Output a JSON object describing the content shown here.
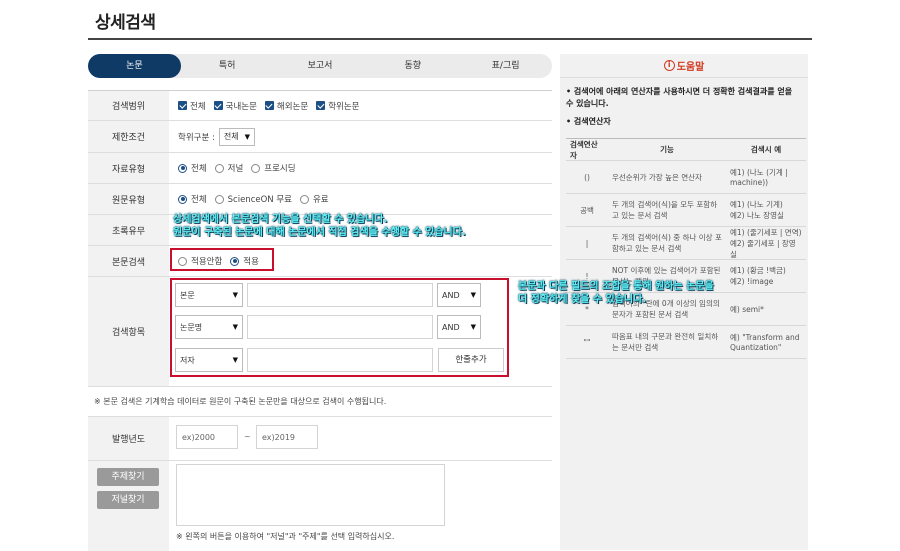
{
  "page": {
    "title": "상세검색"
  },
  "tabs": [
    "논문",
    "특허",
    "보고서",
    "동향",
    "표/그림"
  ],
  "form": {
    "range": {
      "label": "검색범위",
      "options": [
        "전체",
        "국내논문",
        "해외논문",
        "학위논문"
      ]
    },
    "limit": {
      "label": "제한조건",
      "sub_label": "학위구분 :",
      "selected": "전체"
    },
    "material": {
      "label": "자료유형",
      "options": [
        "전체",
        "저널",
        "프로시딩"
      ]
    },
    "original": {
      "label": "원문유형",
      "options": [
        "전체",
        "ScienceON 무료",
        "유료"
      ]
    },
    "abstract": {
      "label": "초록유무"
    },
    "fulltext": {
      "label": "본문검색",
      "options": [
        "적용안함",
        "적용"
      ]
    },
    "search_items": {
      "label": "검색항목",
      "rows": [
        {
          "field": "본문",
          "op": "AND"
        },
        {
          "field": "논문명",
          "op": "AND"
        },
        {
          "field": "저자",
          "add": "한줄추가"
        }
      ]
    },
    "note": "※ 본문 검색은 기계학습 데이터로 원문이 구축된 논문만을 대상으로 검색이 수행됩니다.",
    "year": {
      "label": "발행년도",
      "from_placeholder": "ex)2000",
      "sep": "~",
      "to_placeholder": "ex)2019"
    },
    "subject_btn": "주제찾기",
    "journal_btn": "저널찾기",
    "bottom_note": "※ 왼쪽의 버튼을 이용하여 \"저널\"과 \"주제\"를 선택 입력하십시오."
  },
  "callouts": {
    "one_line1": "상세검색에서 본문검색 기능을 선택할 수 있습니다.",
    "one_line2": "원문이 구축된 논문에 대해 논문에서 직접 검색을 수행할 수 있습니다.",
    "two_line1": "본문과 다른 필드의 조합을 통해 원하는 논문을",
    "two_line2": "더 정확하게 찾을 수 있습니다."
  },
  "help": {
    "header": "도움말",
    "icon_char": "i",
    "intro": "• 검색어에 아래의 연산자를 사용하시면 더 정확한 검색결과를 얻을 수 있습니다.",
    "ops_title": "• 검색연산자",
    "table_head": [
      "검색연산자",
      "기능",
      "검색시 예"
    ],
    "rows": [
      {
        "op": "()",
        "desc": "우선순위가 가장 높은 연산자",
        "ex": "예1) (나노 (기계 | machine))"
      },
      {
        "op": "공백",
        "desc": "두 개의 검색어(식)을 모두 포함하고 있는 문서 검색",
        "ex": "예1) (나노 기계)\n예2) 나노 장영실"
      },
      {
        "op": "|",
        "desc": "두 개의 검색어(식) 중 하나 이상 포함하고 있는 문서 검색",
        "ex": "예1) (줄기세포 | 면역)\n예2) 줄기세포 | 장영실"
      },
      {
        "op": "!",
        "desc": "NOT 이후에 있는 검색어가 포함된 문서는 제외",
        "ex": "예1) (황금 !백금)\n예2) !image"
      },
      {
        "op": "*",
        "desc": "검색어의 *란에 0개 이상의 임의의 문자가 포함된 문서 검색",
        "ex": "예) semi*"
      },
      {
        "op": "\"\"",
        "desc": "따옴표 내의 구문과 완전히 일치하는 문서만 검색",
        "ex": "예) \"Transform and Quantization\""
      }
    ]
  }
}
